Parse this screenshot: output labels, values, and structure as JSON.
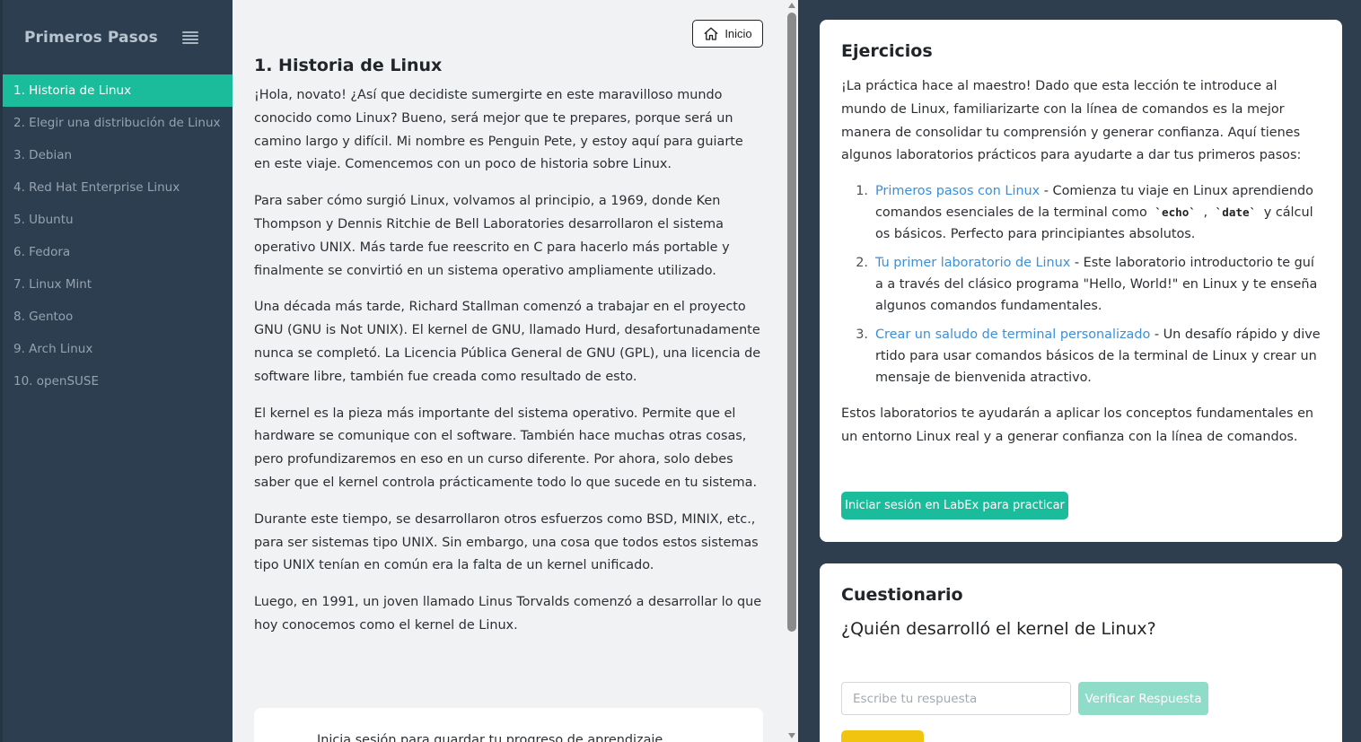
{
  "sidebar": {
    "title": "Primeros Pasos",
    "items": [
      {
        "label": "1. Historia de Linux",
        "active": true
      },
      {
        "label": "2. Elegir una distribución de Linux"
      },
      {
        "label": "3. Debian"
      },
      {
        "label": "4. Red Hat Enterprise Linux"
      },
      {
        "label": "5. Ubuntu"
      },
      {
        "label": "6. Fedora"
      },
      {
        "label": "7. Linux Mint"
      },
      {
        "label": "8. Gentoo"
      },
      {
        "label": "9. Arch Linux"
      },
      {
        "label": "10. openSUSE"
      }
    ]
  },
  "content": {
    "home_label": "Inicio",
    "title": "1. Historia de Linux",
    "paragraphs": [
      "¡Hola, novato! ¿Así que decidiste sumergirte en este maravilloso mundo conocido como Linux? Bueno, será mejor que te prepares, porque será un camino largo y difícil. Mi nombre es Penguin Pete, y estoy aquí para guiarte en este viaje. Comencemos con un poco de historia sobre Linux.",
      "Para saber cómo surgió Linux, volvamos al principio, a 1969, donde Ken Thompson y Dennis Ritchie de Bell Laboratories desarrollaron el sistema operativo UNIX. Más tarde fue reescrito en C para hacerlo más portable y finalmente se convirtió en un sistema operativo ampliamente utilizado.",
      "Una década más tarde, Richard Stallman comenzó a trabajar en el proyecto GNU (GNU is Not UNIX). El kernel de GNU, llamado Hurd, desafortunadamente nunca se completó. La Licencia Pública General de GNU (GPL), una licencia de software libre, también fue creada como resultado de esto.",
      "El kernel es la pieza más importante del sistema operativo. Permite que el hardware se comunique con el software. También hace muchas otras cosas, pero profundizaremos en eso en un curso diferente. Por ahora, solo debes saber que el kernel controla prácticamente todo lo que sucede en tu sistema.",
      "Durante este tiempo, se desarrollaron otros esfuerzos como BSD, MINIX, etc., para ser sistemas tipo UNIX. Sin embargo, una cosa que todos estos sistemas tipo UNIX tenían en común era la falta de un kernel unificado.",
      "Luego, en 1991, un joven llamado Linus Torvalds comenzó a desarrollar lo que hoy conocemos como el kernel de Linux."
    ],
    "progress_text": "Inicia sesión para guardar tu progreso de aprendizaje"
  },
  "exercises": {
    "title": "Ejercicios",
    "intro": "¡La práctica hace al maestro! Dado que esta lección te introduce al mundo de Linux, familiarizarte con la línea de comandos es la mejor manera de consolidar tu comprensión y generar confianza. Aquí tienes algunos laboratorios prácticos para ayudarte a dar tus primeros pasos:",
    "items": [
      {
        "num": "1.",
        "link": "Primeros pasos con Linux",
        "text_before": " - Comienza tu viaje en Linux aprendiendo comandos esenciales de la terminal como ",
        "code1": "`echo`",
        "sep": " , ",
        "code2": "`date`",
        "text_after": " y cálculos básicos. Perfecto para principiantes absolutos."
      },
      {
        "num": "2.",
        "link": "Tu primer laboratorio de Linux",
        "text": " - Este laboratorio introductorio te guía a través del clásico programa \"Hello, World!\" en Linux y te enseña algunos comandos fundamentales."
      },
      {
        "num": "3.",
        "link": "Crear un saludo de terminal personalizado",
        "text": " - Un desafío rápido y divertido para usar comandos básicos de la terminal de Linux y crear un mensaje de bienvenida atractivo."
      }
    ],
    "outro": "Estos laboratorios te ayudarán a aplicar los conceptos fundamentales en un entorno Linux real y a generar confianza con la línea de comandos.",
    "login_label": "Iniciar sesión en LabEx para practicar"
  },
  "quiz": {
    "title": "Cuestionario",
    "question": "¿Quién desarrolló el kernel de Linux?",
    "input_placeholder": "Escribe tu respuesta",
    "verify_label": "Verificar Respuesta"
  },
  "colors": {
    "accent": "#1abc9c",
    "sidebar_bg": "#2c3e50",
    "link": "#3b8fd9",
    "hint": "#f1c40f"
  }
}
